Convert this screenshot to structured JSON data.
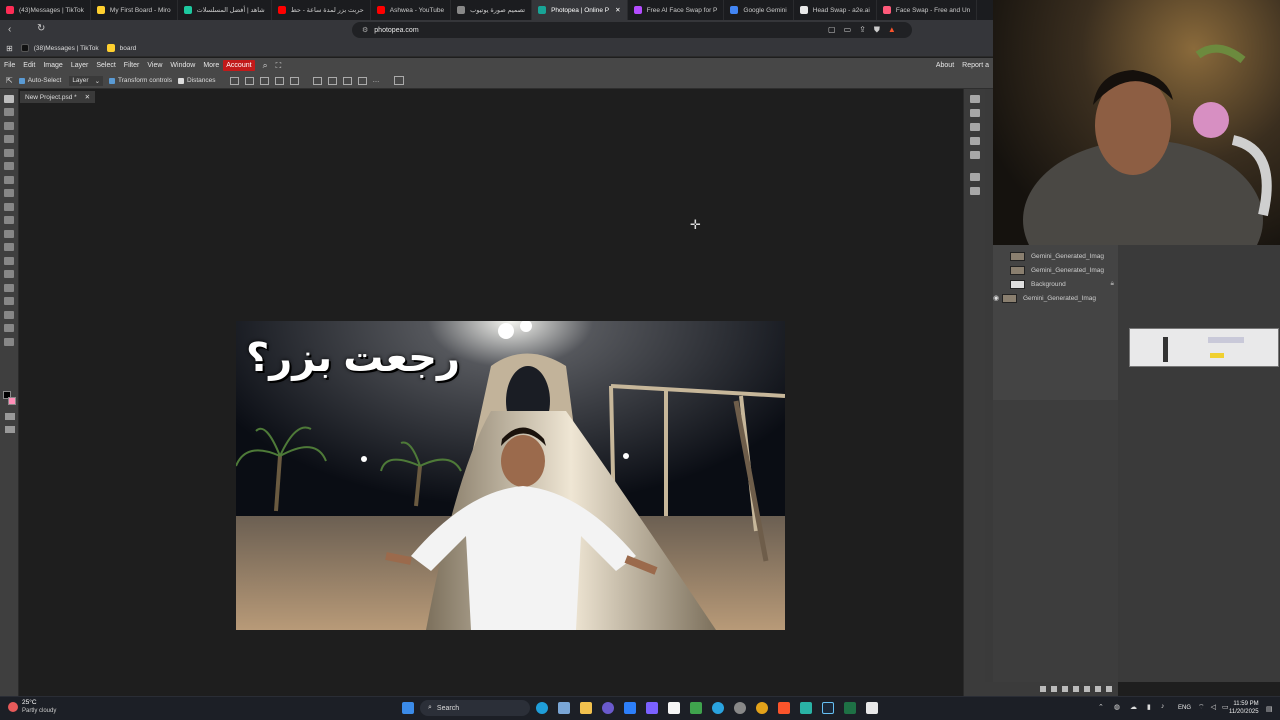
{
  "browser": {
    "tabs": [
      {
        "label": "(43)Messages | TikTok",
        "color": "#fe2c55"
      },
      {
        "label": "My First Board - Miro",
        "color": "#ffd02f"
      },
      {
        "label": "شاهد | أفضل المسلسلات",
        "color": "#1dc9a0"
      },
      {
        "label": "حربت بزر لمدة ساعة - حط",
        "color": "#ff0000"
      },
      {
        "label": "Ashwea - YouTube",
        "color": "#ff0000"
      },
      {
        "label": "تصميم صورة يوتيوب",
        "color": "#888888"
      },
      {
        "label": "Photopea | Online P",
        "color": "#18a497"
      },
      {
        "label": "Free AI Face Swap for P",
        "color": "#b44cff"
      },
      {
        "label": "Google Gemini",
        "color": "#4285f4"
      },
      {
        "label": "Head Swap - a2e.ai",
        "color": "#e8e8e8"
      },
      {
        "label": "Face Swap - Free and Un",
        "color": "#ff5a7a"
      }
    ],
    "url": "photopea.com",
    "bookmarks": [
      {
        "label": "(38)Messages | TikTok"
      },
      {
        "label": "board"
      }
    ]
  },
  "photopea": {
    "menu": [
      "File",
      "Edit",
      "Image",
      "Layer",
      "Select",
      "Filter",
      "View",
      "Window",
      "More",
      "Account"
    ],
    "menu_right": [
      "About",
      "Report a"
    ],
    "options": {
      "auto_select": "Auto-Select",
      "layer_select": "Layer",
      "transform_controls": "Transform controls",
      "distances": "Distances"
    },
    "doc_tab": "New Project.psd *",
    "thumbnail_title": "رجعت بزر؟",
    "layers": [
      {
        "name": "Gemini_Generated_Imag",
        "visible": false
      },
      {
        "name": "Gemini_Generated_Imag",
        "visible": false
      },
      {
        "name": "Background",
        "visible": false,
        "locked": true
      },
      {
        "name": "Gemini_Generated_Imag",
        "visible": true
      }
    ]
  },
  "taskbar": {
    "temperature": "25°C",
    "weather": "Partly cloudy",
    "search": "Search",
    "lang": "ENG",
    "time": "11:59 PM",
    "date": "11/20/2025"
  }
}
